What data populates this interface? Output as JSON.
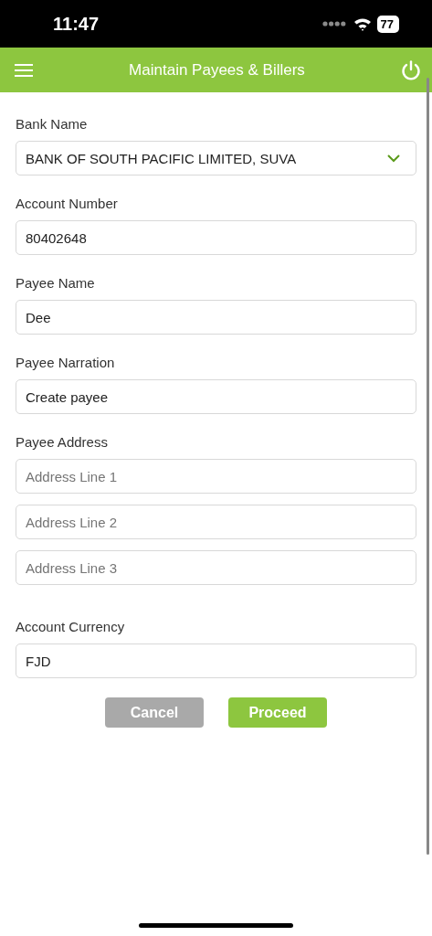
{
  "status_bar": {
    "time": "11:47",
    "battery": "77"
  },
  "header": {
    "title": "Maintain Payees & Billers"
  },
  "fields": [
    {
      "label": "Bank Name",
      "kind": "select",
      "inputs": [
        {
          "value": "BANK OF SOUTH PACIFIC LIMITED, SUVA"
        }
      ]
    },
    {
      "label": "Account Number",
      "kind": "text",
      "inputs": [
        {
          "value": "80402648"
        }
      ]
    },
    {
      "label": "Payee Name",
      "kind": "text",
      "inputs": [
        {
          "value": "Dee"
        }
      ]
    },
    {
      "label": "Payee Narration",
      "kind": "text",
      "inputs": [
        {
          "value": "Create payee"
        }
      ]
    },
    {
      "label": "Payee Address",
      "kind": "text",
      "inputs": [
        {
          "placeholder": "Address Line 1"
        },
        {
          "placeholder": "Address Line 2"
        },
        {
          "placeholder": "Address Line 3"
        }
      ]
    },
    {
      "label": "Account Currency",
      "kind": "text",
      "inputs": [
        {
          "value": "FJD"
        }
      ]
    }
  ],
  "buttons": [
    {
      "label": "Cancel",
      "kind": "secondary"
    },
    {
      "label": "Proceed",
      "kind": "primary"
    }
  ]
}
